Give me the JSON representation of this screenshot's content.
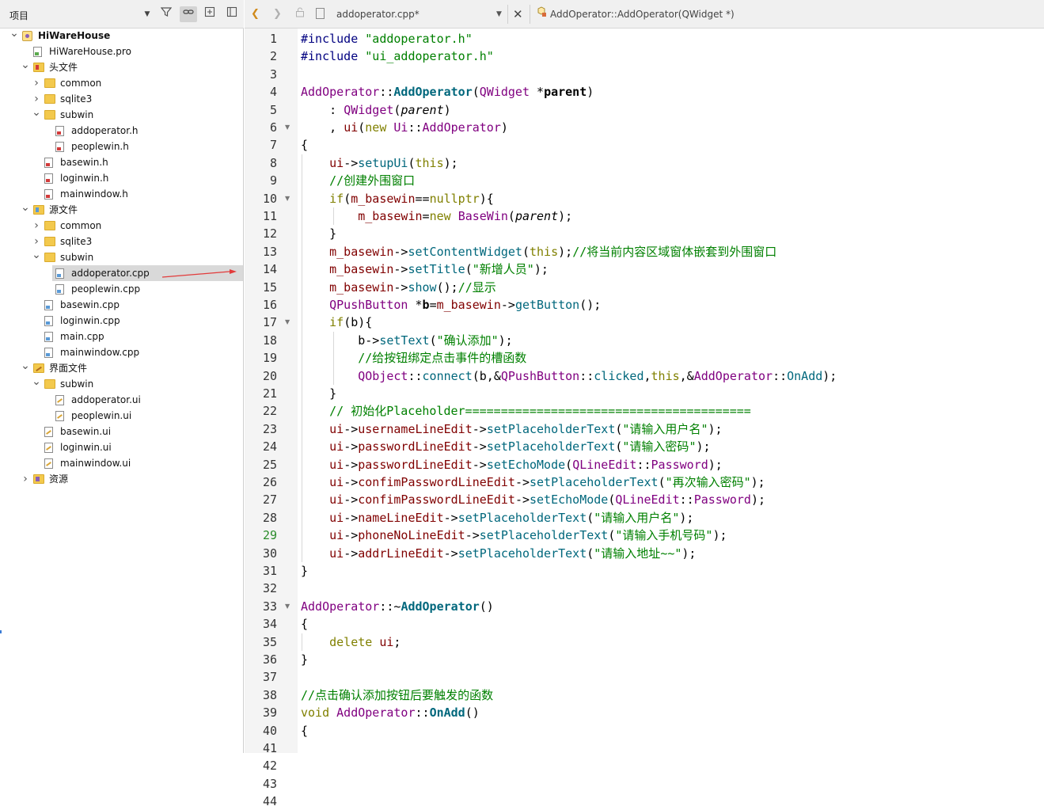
{
  "left_panel": {
    "title": "项目",
    "tree": [
      {
        "level": 0,
        "arrow": "down",
        "icon": "project",
        "label": "HiWareHouse",
        "bold": true
      },
      {
        "level": 1,
        "arrow": "",
        "icon": "file-pro",
        "label": "HiWareHouse.pro"
      },
      {
        "level": 1,
        "arrow": "down",
        "icon": "vfolder-h",
        "label": "头文件"
      },
      {
        "level": 2,
        "arrow": "right",
        "icon": "folder",
        "label": "common"
      },
      {
        "level": 2,
        "arrow": "right",
        "icon": "folder",
        "label": "sqlite3"
      },
      {
        "level": 2,
        "arrow": "down",
        "icon": "folder",
        "label": "subwin"
      },
      {
        "level": 3,
        "arrow": "",
        "icon": "file-h",
        "label": "addoperator.h"
      },
      {
        "level": 3,
        "arrow": "",
        "icon": "file-h",
        "label": "peoplewin.h"
      },
      {
        "level": 2,
        "arrow": "",
        "icon": "file-h",
        "label": "basewin.h"
      },
      {
        "level": 2,
        "arrow": "",
        "icon": "file-h",
        "label": "loginwin.h"
      },
      {
        "level": 2,
        "arrow": "",
        "icon": "file-h",
        "label": "mainwindow.h"
      },
      {
        "level": 1,
        "arrow": "down",
        "icon": "vfolder-src",
        "label": "源文件"
      },
      {
        "level": 2,
        "arrow": "right",
        "icon": "folder",
        "label": "common"
      },
      {
        "level": 2,
        "arrow": "right",
        "icon": "folder",
        "label": "sqlite3"
      },
      {
        "level": 2,
        "arrow": "down",
        "icon": "folder",
        "label": "subwin"
      },
      {
        "level": 3,
        "arrow": "",
        "icon": "file-cpp",
        "label": "addoperator.cpp",
        "selected": true
      },
      {
        "level": 3,
        "arrow": "",
        "icon": "file-cpp",
        "label": "peoplewin.cpp"
      },
      {
        "level": 2,
        "arrow": "",
        "icon": "file-cpp",
        "label": "basewin.cpp"
      },
      {
        "level": 2,
        "arrow": "",
        "icon": "file-cpp",
        "label": "loginwin.cpp"
      },
      {
        "level": 2,
        "arrow": "",
        "icon": "file-cpp",
        "label": "main.cpp"
      },
      {
        "level": 2,
        "arrow": "",
        "icon": "file-cpp",
        "label": "mainwindow.cpp"
      },
      {
        "level": 1,
        "arrow": "down",
        "icon": "vfolder-form",
        "label": "界面文件"
      },
      {
        "level": 2,
        "arrow": "down",
        "icon": "folder",
        "label": "subwin"
      },
      {
        "level": 3,
        "arrow": "",
        "icon": "file-ui",
        "label": "addoperator.ui"
      },
      {
        "level": 3,
        "arrow": "",
        "icon": "file-ui",
        "label": "peoplewin.ui"
      },
      {
        "level": 2,
        "arrow": "",
        "icon": "file-ui",
        "label": "basewin.ui"
      },
      {
        "level": 2,
        "arrow": "",
        "icon": "file-ui",
        "label": "loginwin.ui"
      },
      {
        "level": 2,
        "arrow": "",
        "icon": "file-ui",
        "label": "mainwindow.ui"
      },
      {
        "level": 1,
        "arrow": "right",
        "icon": "vfolder-res",
        "label": "资源"
      }
    ]
  },
  "editor": {
    "file_name": "addoperator.cpp*",
    "symbol": "AddOperator::AddOperator(QWidget *)",
    "current_line": 29,
    "colors": {
      "keyword": "#808000",
      "type": "#800080",
      "function": "#00677c",
      "string": "#008000",
      "comment": "#008000",
      "preproc": "#000080",
      "member": "#800000"
    },
    "lines": [
      [
        [
          "#include ",
          "p"
        ],
        [
          "\"addoperator.h\"",
          "s"
        ]
      ],
      [
        [
          "#include ",
          "p"
        ],
        [
          "\"ui_addoperator.h\"",
          "s"
        ]
      ],
      [],
      [
        [
          "AddOperator",
          "t"
        ],
        [
          "::",
          "n"
        ],
        [
          "AddOperator",
          "fb"
        ],
        [
          "(",
          "n"
        ],
        [
          "QWidget",
          "t"
        ],
        [
          " *",
          "n"
        ],
        [
          "parent",
          "b"
        ],
        [
          ")",
          "n"
        ]
      ],
      [
        [
          "    : ",
          "n"
        ],
        [
          "QWidget",
          "t"
        ],
        [
          "(",
          "n"
        ],
        [
          "parent",
          "pi"
        ],
        [
          ")",
          "n"
        ]
      ],
      [
        [
          "    , ",
          "n"
        ],
        [
          "ui",
          "m"
        ],
        [
          "(",
          "n"
        ],
        [
          "new ",
          "k"
        ],
        [
          "Ui",
          "t"
        ],
        [
          "::",
          "n"
        ],
        [
          "AddOperator",
          "t"
        ],
        [
          ")",
          "n"
        ]
      ],
      [
        [
          "{",
          "n"
        ]
      ],
      [
        [
          "    ",
          "n"
        ],
        [
          "ui",
          "m"
        ],
        [
          "->",
          "n"
        ],
        [
          "setupUi",
          "f"
        ],
        [
          "(",
          "n"
        ],
        [
          "this",
          "k"
        ],
        [
          ");",
          "n"
        ]
      ],
      [
        [
          "    //创建外围窗口",
          "c"
        ]
      ],
      [
        [
          "    ",
          "n"
        ],
        [
          "if",
          "k"
        ],
        [
          "(",
          "n"
        ],
        [
          "m_basewin",
          "m"
        ],
        [
          "==",
          "n"
        ],
        [
          "nullptr",
          "k"
        ],
        [
          "){",
          "n"
        ]
      ],
      [
        [
          "        ",
          "n"
        ],
        [
          "m_basewin",
          "m"
        ],
        [
          "=",
          "n"
        ],
        [
          "new ",
          "k"
        ],
        [
          "BaseWin",
          "t"
        ],
        [
          "(",
          "n"
        ],
        [
          "parent",
          "pi"
        ],
        [
          ");",
          "n"
        ]
      ],
      [
        [
          "    }",
          "n"
        ]
      ],
      [
        [
          "    ",
          "n"
        ],
        [
          "m_basewin",
          "m"
        ],
        [
          "->",
          "n"
        ],
        [
          "setContentWidget",
          "f"
        ],
        [
          "(",
          "n"
        ],
        [
          "this",
          "k"
        ],
        [
          ");",
          "n"
        ],
        [
          "//将当前内容区域窗体嵌套到外围窗口",
          "c"
        ]
      ],
      [
        [
          "    ",
          "n"
        ],
        [
          "m_basewin",
          "m"
        ],
        [
          "->",
          "n"
        ],
        [
          "setTitle",
          "f"
        ],
        [
          "(",
          "n"
        ],
        [
          "\"新增人员\"",
          "s"
        ],
        [
          ");",
          "n"
        ]
      ],
      [
        [
          "    ",
          "n"
        ],
        [
          "m_basewin",
          "m"
        ],
        [
          "->",
          "n"
        ],
        [
          "show",
          "f"
        ],
        [
          "();",
          "n"
        ],
        [
          "//显示",
          "c"
        ]
      ],
      [
        [
          "    ",
          "n"
        ],
        [
          "QPushButton",
          "t"
        ],
        [
          " *",
          "n"
        ],
        [
          "b",
          "b"
        ],
        [
          "=",
          "n"
        ],
        [
          "m_basewin",
          "m"
        ],
        [
          "->",
          "n"
        ],
        [
          "getButton",
          "f"
        ],
        [
          "();",
          "n"
        ]
      ],
      [
        [
          "    ",
          "n"
        ],
        [
          "if",
          "k"
        ],
        [
          "(b){",
          "n"
        ]
      ],
      [
        [
          "        b->",
          "n"
        ],
        [
          "setText",
          "f"
        ],
        [
          "(",
          "n"
        ],
        [
          "\"确认添加\"",
          "s"
        ],
        [
          ");",
          "n"
        ]
      ],
      [
        [
          "        //给按钮绑定点击事件的槽函数",
          "c"
        ]
      ],
      [
        [
          "        ",
          "n"
        ],
        [
          "QObject",
          "t"
        ],
        [
          "::",
          "n"
        ],
        [
          "connect",
          "f"
        ],
        [
          "(b,&",
          "n"
        ],
        [
          "QPushButton",
          "t"
        ],
        [
          "::",
          "n"
        ],
        [
          "clicked",
          "f"
        ],
        [
          ",",
          "n"
        ],
        [
          "this",
          "k"
        ],
        [
          ",&",
          "n"
        ],
        [
          "AddOperator",
          "t"
        ],
        [
          "::",
          "n"
        ],
        [
          "OnAdd",
          "f"
        ],
        [
          ");",
          "n"
        ]
      ],
      [
        [
          "    }",
          "n"
        ]
      ],
      [
        [
          "    // 初始化Placeholder========================================",
          "c"
        ]
      ],
      [
        [
          "    ",
          "n"
        ],
        [
          "ui",
          "m"
        ],
        [
          "->",
          "n"
        ],
        [
          "usernameLineEdit",
          "m"
        ],
        [
          "->",
          "n"
        ],
        [
          "setPlaceholderText",
          "f"
        ],
        [
          "(",
          "n"
        ],
        [
          "\"请输入用户名\"",
          "s"
        ],
        [
          ");",
          "n"
        ]
      ],
      [
        [
          "    ",
          "n"
        ],
        [
          "ui",
          "m"
        ],
        [
          "->",
          "n"
        ],
        [
          "passwordLineEdit",
          "m"
        ],
        [
          "->",
          "n"
        ],
        [
          "setPlaceholderText",
          "f"
        ],
        [
          "(",
          "n"
        ],
        [
          "\"请输入密码\"",
          "s"
        ],
        [
          ");",
          "n"
        ]
      ],
      [
        [
          "    ",
          "n"
        ],
        [
          "ui",
          "m"
        ],
        [
          "->",
          "n"
        ],
        [
          "passwordLineEdit",
          "m"
        ],
        [
          "->",
          "n"
        ],
        [
          "setEchoMode",
          "f"
        ],
        [
          "(",
          "n"
        ],
        [
          "QLineEdit",
          "t"
        ],
        [
          "::",
          "n"
        ],
        [
          "Password",
          "t"
        ],
        [
          ");",
          "n"
        ]
      ],
      [
        [
          "    ",
          "n"
        ],
        [
          "ui",
          "m"
        ],
        [
          "->",
          "n"
        ],
        [
          "confimPasswordLineEdit",
          "m"
        ],
        [
          "->",
          "n"
        ],
        [
          "setPlaceholderText",
          "f"
        ],
        [
          "(",
          "n"
        ],
        [
          "\"再次输入密码\"",
          "s"
        ],
        [
          ");",
          "n"
        ]
      ],
      [
        [
          "    ",
          "n"
        ],
        [
          "ui",
          "m"
        ],
        [
          "->",
          "n"
        ],
        [
          "confimPasswordLineEdit",
          "m"
        ],
        [
          "->",
          "n"
        ],
        [
          "setEchoMode",
          "f"
        ],
        [
          "(",
          "n"
        ],
        [
          "QLineEdit",
          "t"
        ],
        [
          "::",
          "n"
        ],
        [
          "Password",
          "t"
        ],
        [
          ");",
          "n"
        ]
      ],
      [
        [
          "    ",
          "n"
        ],
        [
          "ui",
          "m"
        ],
        [
          "->",
          "n"
        ],
        [
          "nameLineEdit",
          "m"
        ],
        [
          "->",
          "n"
        ],
        [
          "setPlaceholderText",
          "f"
        ],
        [
          "(",
          "n"
        ],
        [
          "\"请输入用户名\"",
          "s"
        ],
        [
          ");",
          "n"
        ]
      ],
      [
        [
          "    ",
          "n"
        ],
        [
          "ui",
          "m"
        ],
        [
          "->",
          "n"
        ],
        [
          "phoneNoLineEdit",
          "m"
        ],
        [
          "->",
          "n"
        ],
        [
          "setPlaceholderText",
          "f"
        ],
        [
          "(",
          "n"
        ],
        [
          "\"请输入手机号码\"",
          "s"
        ],
        [
          ");",
          "n"
        ]
      ],
      [
        [
          "    ",
          "n"
        ],
        [
          "ui",
          "m"
        ],
        [
          "->",
          "n"
        ],
        [
          "addrLineEdit",
          "m"
        ],
        [
          "->",
          "n"
        ],
        [
          "setPlaceholderText",
          "f"
        ],
        [
          "(",
          "n"
        ],
        [
          "\"请输入地址~~\"",
          "s"
        ],
        [
          ");",
          "n"
        ]
      ],
      [
        [
          "}",
          "n"
        ]
      ],
      [],
      [
        [
          "AddOperator",
          "t"
        ],
        [
          "::~",
          "n"
        ],
        [
          "AddOperator",
          "fb"
        ],
        [
          "()",
          "n"
        ]
      ],
      [
        [
          "{",
          "n"
        ]
      ],
      [
        [
          "    ",
          "n"
        ],
        [
          "delete ",
          "k"
        ],
        [
          "ui",
          "m"
        ],
        [
          ";",
          "n"
        ]
      ],
      [
        [
          "}",
          "n"
        ]
      ],
      [],
      [
        [
          "//点击确认添加按钮后要触发的函数",
          "c"
        ]
      ],
      [
        [
          "void ",
          "k"
        ],
        [
          "AddOperator",
          "t"
        ],
        [
          "::",
          "n"
        ],
        [
          "OnAdd",
          "fb"
        ],
        [
          "()",
          "n"
        ]
      ],
      [
        [
          "{",
          "n"
        ]
      ],
      [],
      [
        [
          "}",
          "n"
        ]
      ],
      [],
      []
    ],
    "fold_lines": [
      6,
      10,
      17,
      33
    ]
  }
}
